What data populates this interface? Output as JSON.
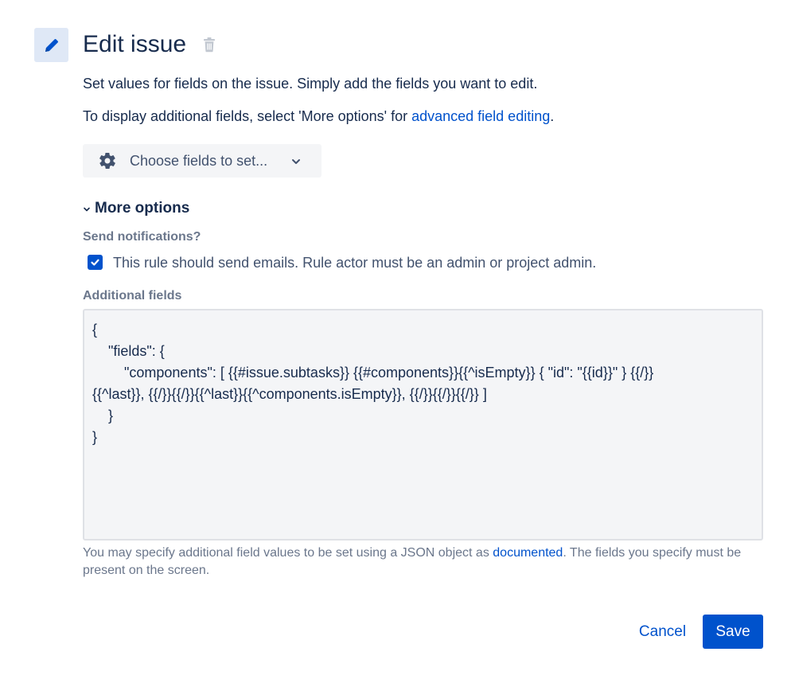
{
  "header": {
    "title": "Edit issue",
    "icon": "pencil-icon",
    "delete_icon": "trash-icon"
  },
  "description": {
    "line1": "Set values for fields on the issue. Simply add the fields you want to edit.",
    "line2_prefix": "To display additional fields, select 'More options' for ",
    "line2_link": "advanced field editing",
    "line2_suffix": "."
  },
  "choose_fields": {
    "label": "Choose fields to set...",
    "icon": "gear-icon"
  },
  "more_options": {
    "label": "More options",
    "expanded": true
  },
  "notifications": {
    "label": "Send notifications?",
    "checkbox_text": "This rule should send emails. Rule actor must be an admin or project admin.",
    "checked": true
  },
  "additional_fields": {
    "label": "Additional fields",
    "lines": [
      "{",
      "    \"fields\": {",
      "        \"components\": [ {{#issue.subtasks}} {{#components}}{{^isEmpty}} { \"id\": \"{{id}}\" } {{/}}",
      "{{^last}}, {{/}}{{/}}{{^last}}{{^components.isEmpty}}, {{/}}{{/}}{{/}} ]",
      "    }",
      "}"
    ]
  },
  "helper": {
    "prefix": "You may specify additional field values to be set using a JSON object as ",
    "link": "documented",
    "suffix": ". The fields you specify must be present on the screen."
  },
  "actions": {
    "cancel": "Cancel",
    "save": "Save"
  },
  "colors": {
    "primary": "#0052cc",
    "text": "#172b4d",
    "subtle": "#6b778c",
    "icon_bg": "#dfe8f6"
  }
}
